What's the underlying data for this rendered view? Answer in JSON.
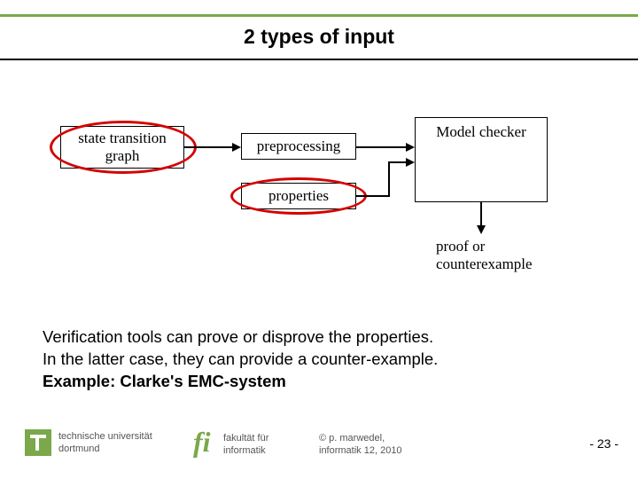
{
  "title": "2 types of input",
  "diagram": {
    "state_transition": "state transition\ngraph",
    "preprocessing": "preprocessing",
    "properties": "properties",
    "model_checker": "Model checker",
    "output": "proof or\ncounterexample"
  },
  "body": {
    "line1": "Verification tools can prove or disprove the properties.",
    "line2": "In the latter case, they can provide a counter-example.",
    "line3": "Example: Clarke's EMC-system"
  },
  "footer": {
    "uni1": "technische universität",
    "uni2": "dortmund",
    "fac1": "fakultät für",
    "fac2": "informatik",
    "copy1": "©  p. marwedel,",
    "copy2": "informatik 12,  2010",
    "page": "-  23 -"
  }
}
